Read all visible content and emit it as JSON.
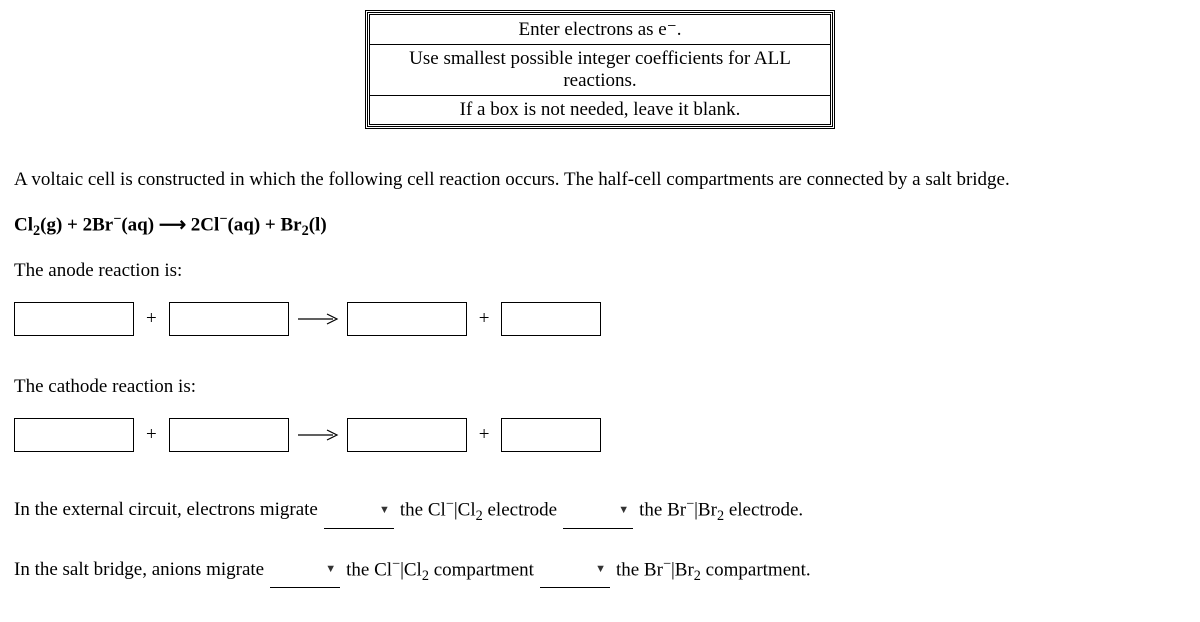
{
  "instructions": {
    "line1": "Enter electrons as e⁻.",
    "line2": "Use smallest possible integer coefficients for ALL reactions.",
    "line3": "If a box is not needed, leave it blank."
  },
  "intro": "A voltaic cell is constructed in which the following cell reaction occurs. The half-cell compartments are connected by a salt bridge.",
  "equation_html": "Cl<sub>2</sub>(g) + 2Br<sup>−</sup>(aq) ⟶ 2Cl<sup>−</sup>(aq) + Br<sub>2</sub>(l)",
  "anode_label": "The anode reaction is:",
  "cathode_label": "The cathode reaction is:",
  "symbols": {
    "plus": "+"
  },
  "q1": {
    "prefix": "In the external circuit, electrons migrate",
    "mid_html": "the Cl<sup>−</sup>|Cl<sub>2</sub> electrode",
    "suffix_html": "the Br<sup>−</sup>|Br<sub>2</sub> electrode."
  },
  "q2": {
    "prefix": "In the salt bridge, anions migrate",
    "mid_html": "the Cl<sup>−</sup>|Cl<sub>2</sub> compartment",
    "suffix_html": "the Br<sup>−</sup>|Br<sub>2</sub> compartment."
  }
}
